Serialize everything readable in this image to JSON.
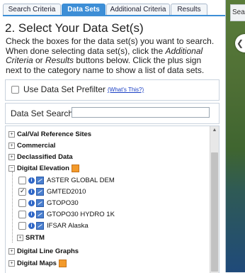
{
  "tabs": [
    {
      "label": "Search Criteria"
    },
    {
      "label": "Data Sets",
      "active": true
    },
    {
      "label": "Additional Criteria"
    },
    {
      "label": "Results"
    }
  ],
  "heading": "2. Select Your Data Set(s)",
  "instructions": {
    "part1": "Check the boxes for the data set(s) you want to search. When done selecting data set(s), click the ",
    "link1": "Additional Criteria",
    "part2": " or ",
    "link2": "Results",
    "part3": " buttons below. Click the plus sign next to the category name to show a list of data sets."
  },
  "prefilter": {
    "label": "Use Data Set Prefilter",
    "help": "(What's This?)",
    "checked": false
  },
  "search": {
    "label": "Data Set Search:",
    "value": ""
  },
  "tree": {
    "categories": [
      {
        "label": "Cal/Val Reference Sites",
        "expander": "+"
      },
      {
        "label": "Commercial",
        "expander": "+"
      },
      {
        "label": "Declassified Data",
        "expander": "+"
      },
      {
        "label": "Digital Elevation",
        "expander": "−"
      },
      {
        "label": "SRTM",
        "expander": "+"
      },
      {
        "label": "Digital Line Graphs",
        "expander": "+"
      },
      {
        "label": "Digital Maps",
        "expander": "+"
      }
    ],
    "datasets": [
      {
        "label": "ASTER GLOBAL DEM",
        "checked": false
      },
      {
        "label": "GMTED2010",
        "checked": true
      },
      {
        "label": "GTOPO30",
        "checked": false
      },
      {
        "label": "GTOPO30 HYDRO 1K",
        "checked": false
      },
      {
        "label": "IFSAR Alaska",
        "checked": false
      }
    ]
  },
  "map": {
    "tab_label": "Sear",
    "button_label": "❮"
  },
  "colors": {
    "accent": "#3d8ed6",
    "link": "#1a3fc4",
    "icon_orange": "#f39a2b"
  }
}
